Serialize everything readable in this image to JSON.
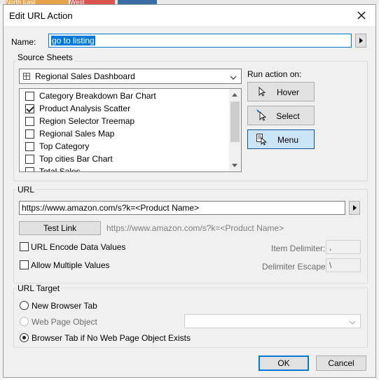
{
  "background": {
    "tabs": [
      "North East",
      "West"
    ]
  },
  "dialog": {
    "title": "Edit URL Action",
    "name_label": "Name:",
    "name_value": "go to listing",
    "source_sheets": {
      "group_title": "Source Sheets",
      "dashboard": "Regional Sales Dashboard",
      "sheets": [
        {
          "label": "Category Breakdown Bar Chart",
          "checked": false
        },
        {
          "label": "Product Analysis Scatter",
          "checked": true
        },
        {
          "label": "Region Selector Treemap",
          "checked": false
        },
        {
          "label": "Regional Sales Map",
          "checked": false
        },
        {
          "label": "Top Category",
          "checked": false
        },
        {
          "label": "Top cities Bar Chart",
          "checked": false
        },
        {
          "label": "Total Sales",
          "checked": false
        }
      ],
      "run_action_label": "Run action on:",
      "run_buttons": [
        {
          "label": "Hover",
          "icon": "pointer-icon",
          "active": false
        },
        {
          "label": "Select",
          "icon": "select-pointer-icon",
          "active": false
        },
        {
          "label": "Menu",
          "icon": "menu-pointer-icon",
          "active": true
        }
      ]
    },
    "url": {
      "group_title": "URL",
      "value": "https://www.amazon.com/s?k=<Product Name>",
      "test_link_label": "Test Link",
      "preview": "https://www.amazon.com/s?k=<Product Name>",
      "encode_label": "URL Encode Data Values",
      "multiple_label": "Allow Multiple Values",
      "item_delimiter_label": "Item Delimiter:",
      "item_delimiter_value": ",",
      "delimiter_escape_label": "Delimiter Escape:",
      "delimiter_escape_value": "\\"
    },
    "url_target": {
      "group_title": "URL Target",
      "options": [
        {
          "label": "New Browser Tab",
          "selected": false,
          "disabled": false
        },
        {
          "label": "Web Page Object",
          "selected": false,
          "disabled": true
        },
        {
          "label": "Browser Tab if No Web Page Object Exists",
          "selected": true,
          "disabled": false
        }
      ]
    },
    "ok_label": "OK",
    "cancel_label": "Cancel"
  },
  "colors": {
    "accent": "#0078d7",
    "dialog_bg": "#f0f0f0",
    "tab_north_east": "#e8a24a",
    "tab_west": "#d9534f"
  }
}
